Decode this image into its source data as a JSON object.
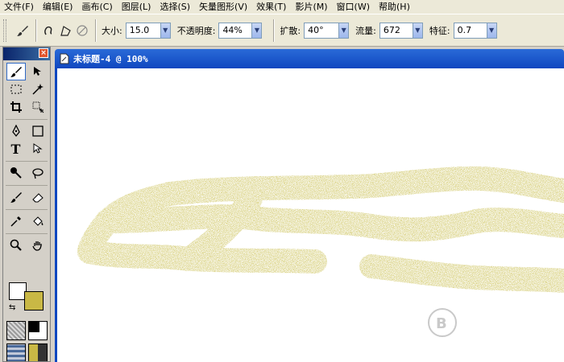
{
  "menubar": {
    "items": [
      "文件(F)",
      "编辑(E)",
      "画布(C)",
      "图层(L)",
      "选择(S)",
      "矢量图形(V)",
      "效果(T)",
      "影片(M)",
      "窗口(W)",
      "帮助(H)"
    ]
  },
  "toolbar": {
    "brush_icon": "brush-icon",
    "size_label": "大小:",
    "size_value": "15.0",
    "opacity_label": "不透明度:",
    "opacity_value": "44%",
    "spread_label": "扩散:",
    "spread_value": "40°",
    "flow_label": "流量:",
    "flow_value": "672",
    "feature_label": "特征:",
    "feature_value": "0.7"
  },
  "document": {
    "title": "未标题-4 @ 100%"
  },
  "colors": {
    "stroke": "#c8bd4b",
    "background_swatch": "#c9b845",
    "title_bar": "#1a55cc"
  }
}
